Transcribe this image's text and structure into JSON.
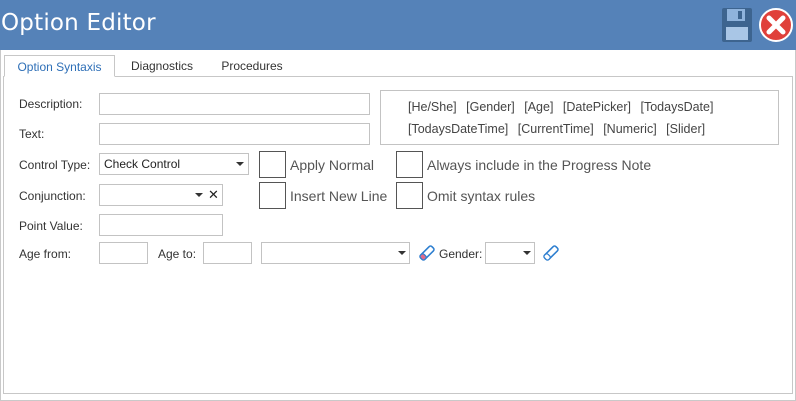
{
  "window": {
    "title": "Option Editor"
  },
  "tabs": [
    {
      "label": "Option Syntaxis",
      "active": true
    },
    {
      "label": "Diagnostics",
      "active": false
    },
    {
      "label": "Procedures",
      "active": false
    }
  ],
  "form": {
    "description_label": "Description:",
    "description_value": "",
    "text_label": "Text:",
    "text_value": "",
    "control_type_label": "Control Type:",
    "control_type_value": "Check Control",
    "conjunction_label": "Conjunction:",
    "conjunction_value": "",
    "clear_symbol": "✕",
    "point_value_label": "Point Value:",
    "point_value": "",
    "age_from_label": "Age from:",
    "age_from_value": "",
    "age_to_label": "Age to:",
    "age_to_value": "",
    "age_unit_value": "",
    "gender_label": "Gender:",
    "gender_value": ""
  },
  "syntax_tokens": {
    "line1": [
      "[He/She]",
      "[Gender]",
      "[Age]",
      "[DatePicker]",
      "[TodaysDate]"
    ],
    "line2": [
      "[TodaysDateTime]",
      "[CurrentTime]",
      "[Numeric]",
      "[Slider]"
    ]
  },
  "checkboxes": {
    "apply_normal": {
      "label": "Apply Normal",
      "checked": false
    },
    "insert_new_line": {
      "label": "Insert New Line",
      "checked": false
    },
    "always_include": {
      "label": "Always include in the Progress Note",
      "checked": false
    },
    "omit_syntax": {
      "label": "Omit syntax rules",
      "checked": false
    }
  },
  "colors": {
    "titlebar": "#5582b8",
    "active_tab_text": "#2e6fb7",
    "close_button": "#e0403a",
    "pencil_blue": "#2e7fd0"
  },
  "icons": {
    "save": "save-icon",
    "close": "close-icon",
    "edit": "pencil-icon"
  }
}
